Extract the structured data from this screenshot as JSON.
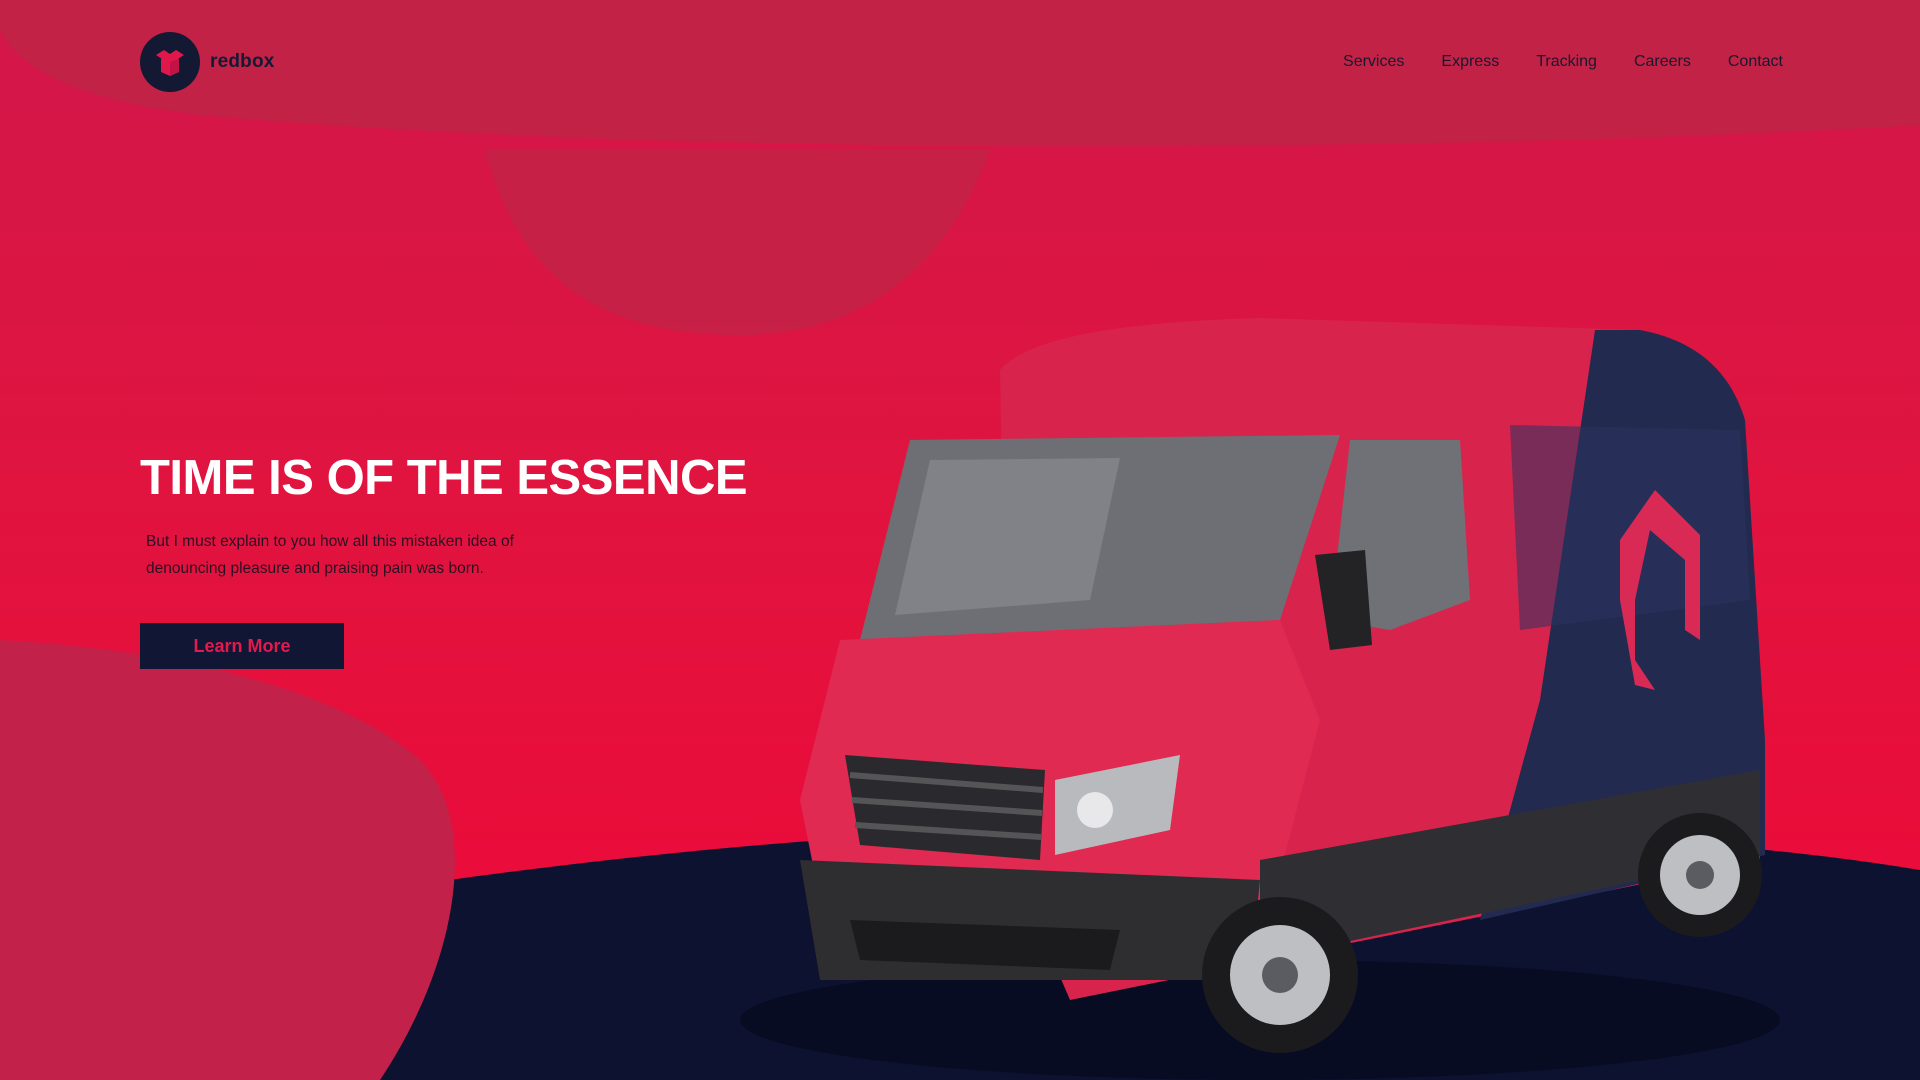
{
  "brand": {
    "name": "redbox",
    "logo_icon": "box-icon"
  },
  "nav": {
    "items": [
      {
        "label": "Services"
      },
      {
        "label": "Express"
      },
      {
        "label": "Tracking"
      },
      {
        "label": "Careers"
      },
      {
        "label": "Contact"
      }
    ]
  },
  "hero": {
    "title": "TIME IS OF THE ESSENCE",
    "description": "But I must explain to you how all this mistaken idea of denouncing pleasure and praising pain was born.",
    "cta_label": "Learn More"
  },
  "colors": {
    "brand_red": "#e0143f",
    "navy": "#111634",
    "header_overlay": "#c22146",
    "light_text": "#ffffff"
  }
}
